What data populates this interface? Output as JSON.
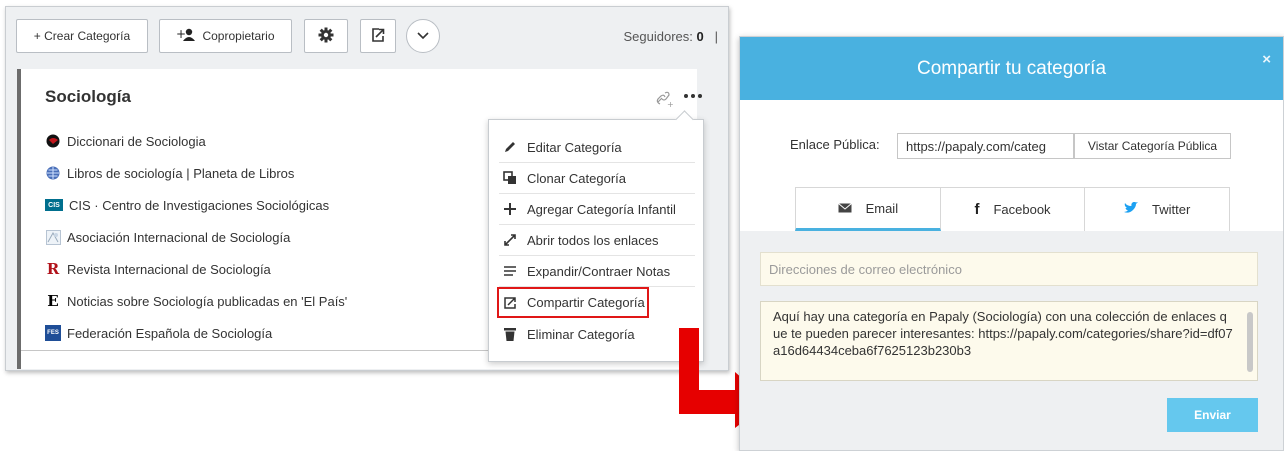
{
  "toolbar": {
    "create_category": "+ Crear Categoría",
    "coowner": "Copropietario",
    "followers_label": "Seguidores:",
    "followers_count": "0",
    "followers_separator": "|"
  },
  "category": {
    "title": "Sociología",
    "links": [
      {
        "label": "Diccionari de Sociologia",
        "icon": "red-globe-icon"
      },
      {
        "label": "Libros de sociología | Planeta de Libros",
        "icon": "blue-globe-icon"
      },
      {
        "label": "CIS · Centro de Investigaciones Sociológicas",
        "icon": "cis-logo-icon",
        "icon_text": "CIS"
      },
      {
        "label": "Asociación Internacional de Sociología",
        "icon": "isa-logo-icon"
      },
      {
        "label": "Revista Internacional de Sociología",
        "icon": "r-logo-icon",
        "icon_text": "R"
      },
      {
        "label": "Noticias sobre Sociología publicadas en 'El País'",
        "icon": "elpais-logo-icon",
        "icon_text": "E"
      },
      {
        "label": "Federación Española de Sociología",
        "icon": "fes-logo-icon",
        "icon_text": "FES"
      }
    ]
  },
  "menu": {
    "items": [
      {
        "label": "Editar Categoría",
        "icon": "pencil-icon"
      },
      {
        "label": "Clonar Categoría",
        "icon": "clone-icon"
      },
      {
        "label": "Agregar Categoría Infantil",
        "icon": "plus-icon"
      },
      {
        "label": "Abrir todos los enlaces",
        "icon": "expand-icon"
      },
      {
        "label": "Expandir/Contraer Notas",
        "icon": "lines-icon"
      },
      {
        "label": "Compartir Categoría",
        "icon": "share-icon"
      },
      {
        "label": "Eliminar Categoría",
        "icon": "trash-icon"
      }
    ]
  },
  "modal": {
    "title": "Compartir tu categoría",
    "close": "×",
    "link_label": "Enlace Pública:",
    "link_value": "https://papaly.com/categ",
    "view_public": "Vistar Categoría Pública",
    "tabs": [
      "Email",
      "Facebook",
      "Twitter"
    ],
    "email_placeholder": "Direcciones de correo electrónico",
    "message": "Aquí hay una categoría en Papaly (Sociología) con una colección de enlaces que te pueden parecer interesantes: https://papaly.com/categories/share?id=df07a16d64434ceba6f7625123b230b3",
    "send": "Enviar"
  },
  "colors": {
    "accent": "#49b1e0",
    "send_button": "#65c8ee",
    "highlight": "#e01717",
    "arrow": "#e60000"
  }
}
